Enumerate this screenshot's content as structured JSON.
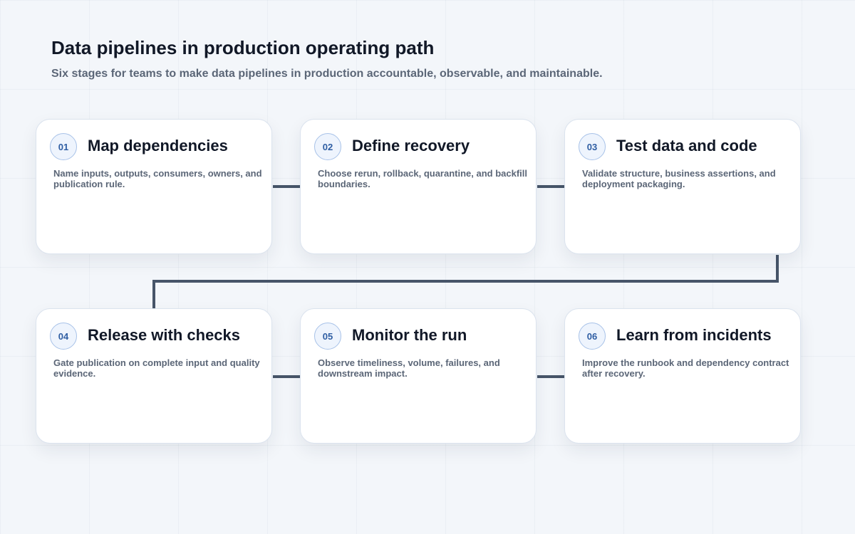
{
  "header": {
    "title": "Data pipelines in production operating path",
    "subtitle": "Six stages for teams to make data pipelines in production accountable, observable, and maintainable."
  },
  "stages": [
    {
      "number": "01",
      "title": "Map dependencies",
      "description": "Name inputs, outputs, consumers, owners, and publication rule."
    },
    {
      "number": "02",
      "title": "Define recovery",
      "description": "Choose rerun, rollback, quarantine, and backfill boundaries."
    },
    {
      "number": "03",
      "title": "Test data and code",
      "description": "Validate structure, business assertions, and deployment packaging."
    },
    {
      "number": "04",
      "title": "Release with checks",
      "description": "Gate publication on complete input and quality evidence."
    },
    {
      "number": "05",
      "title": "Monitor the run",
      "description": "Observe timeliness, volume, failures, and downstream impact."
    },
    {
      "number": "06",
      "title": "Learn from incidents",
      "description": "Improve the runbook and dependency contract after recovery."
    }
  ],
  "colors": {
    "connector": "#475569",
    "badge_text": "#2f5ea3",
    "badge_border": "#a8c2e8",
    "title_text": "#111827",
    "body_text": "#5b6677"
  }
}
